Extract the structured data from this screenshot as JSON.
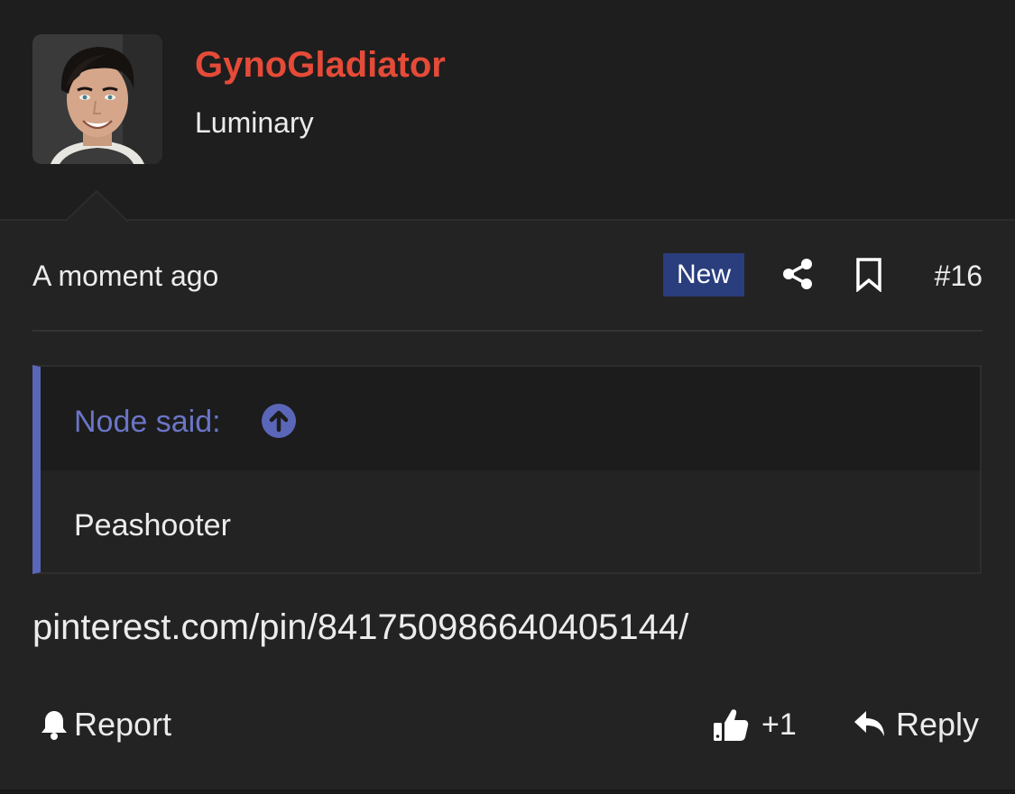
{
  "post": {
    "author": {
      "name": "GynoGladiator",
      "title": "Luminary",
      "name_color": "#e54b38"
    },
    "timestamp": "A moment ago",
    "badge": "New",
    "badge_color": "#2a3e7e",
    "post_number": "#16",
    "quote": {
      "author_line": "Node said:",
      "text": "Peashooter",
      "accent_color": "#5a66b8"
    },
    "body_text": "pinterest.com/pin/841750986640405144/",
    "actions": {
      "report_label": "Report",
      "like_count": "+1",
      "reply_label": "Reply"
    },
    "icons": [
      "share-icon",
      "bookmark-icon",
      "quote-jump-icon",
      "bell-icon",
      "thumbs-up-icon",
      "reply-arrow-icon"
    ]
  }
}
